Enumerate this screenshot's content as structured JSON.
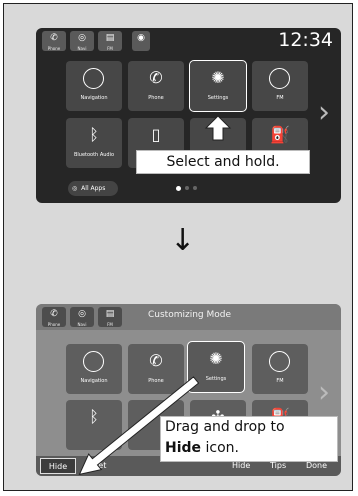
{
  "screen1": {
    "status": {
      "phone_label": "Phone",
      "navi_label": "Navi",
      "fm_label": "FM",
      "clock": "12:34"
    },
    "tiles": [
      {
        "label": "Navigation",
        "icon": "compass-icon"
      },
      {
        "label": "Phone",
        "icon": "phone-icon"
      },
      {
        "label": "Settings",
        "icon": "gear-icon"
      },
      {
        "label": "FM",
        "icon": "radio-icon"
      },
      {
        "label": "Bluetooth Audio",
        "icon": "bluetooth-icon"
      }
    ],
    "all_apps": "All Apps",
    "caption": "Select and hold."
  },
  "screen2": {
    "status": {
      "phone_label": "Phone",
      "navi_label": "Navi",
      "fm_label": "FM",
      "mode_title": "Customizing Mode"
    },
    "tiles": [
      {
        "label": "Navigation",
        "icon": "compass-icon"
      },
      {
        "label": "Phone",
        "icon": "phone-icon"
      },
      {
        "label": "Settings",
        "icon": "gear-icon"
      },
      {
        "label": "FM",
        "icon": "radio-icon"
      }
    ],
    "caption_prefix": "Drag and drop to",
    "caption_bold": "Hide",
    "caption_suffix": " icon.",
    "bottom": {
      "hide": "Hide",
      "reset": "Reset",
      "hide_right": "Hide",
      "tips": "Tips",
      "done": "Done"
    }
  }
}
